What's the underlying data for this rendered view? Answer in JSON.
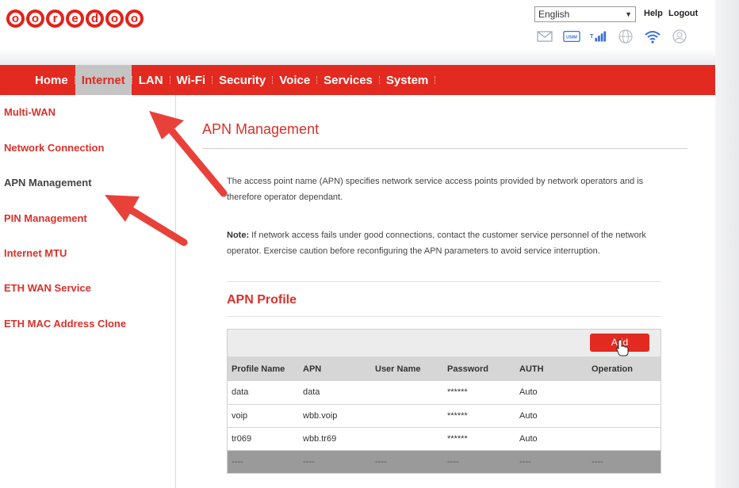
{
  "header": {
    "logo_text": "ooredoo",
    "language": "English",
    "help_label": "Help",
    "logout_label": "Logout",
    "status_icons": [
      "mail-icon",
      "usim-icon",
      "signal-icon",
      "globe-icon",
      "wifi-icon",
      "account-icon"
    ],
    "usim_label": "USIM"
  },
  "nav": {
    "items": [
      "Home",
      "Internet",
      "LAN",
      "Wi-Fi",
      "Security",
      "Voice",
      "Services",
      "System"
    ],
    "active": "Internet"
  },
  "sidebar": {
    "items": [
      "Multi-WAN",
      "Network Connection",
      "APN Management",
      "PIN Management",
      "Internet MTU",
      "ETH WAN Service",
      "ETH MAC Address Clone"
    ],
    "current": "APN Management"
  },
  "main": {
    "title": "APN Management",
    "description": "The access point name (APN) specifies network service access points provided by network operators and is therefore operator dependant.",
    "note_label": "Note:",
    "note_text": " If network access fails under good connections, contact the customer service personnel of the network operator. Exercise caution before reconfiguring the APN parameters to avoid service interruption.",
    "profile_title": "APN Profile",
    "add_label": "Add",
    "columns": [
      "Profile Name",
      "APN",
      "User Name",
      "Password",
      "AUTH",
      "Operation"
    ],
    "rows": [
      [
        "data",
        "data",
        "",
        "******",
        "Auto",
        ""
      ],
      [
        "voip",
        "wbb.voip",
        "",
        "******",
        "Auto",
        ""
      ],
      [
        "tr069",
        "wbb.tr69",
        "",
        "******",
        "Auto",
        ""
      ],
      [
        "----",
        "----",
        "----",
        "----",
        "----",
        "----"
      ]
    ]
  },
  "colors": {
    "brand_red": "#e32a20",
    "active_tab_bg": "#c4c4c4",
    "annotation_arrow": "#e8413a"
  }
}
